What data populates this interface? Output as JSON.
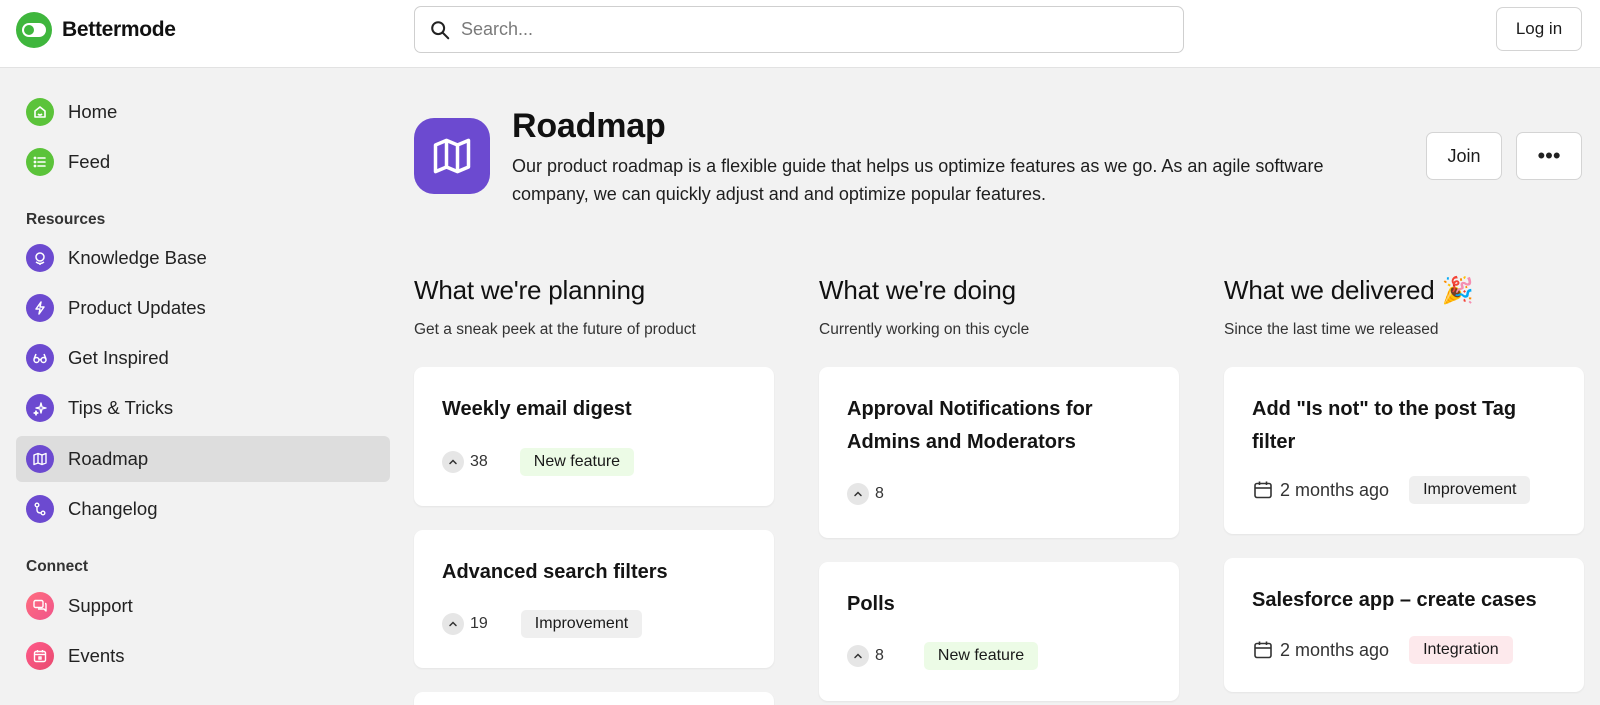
{
  "header": {
    "brand": "Bettermode",
    "search_placeholder": "Search...",
    "login_label": "Log in"
  },
  "sidebar": {
    "items": [
      {
        "label": "Home",
        "icon": "home-icon"
      },
      {
        "label": "Feed",
        "icon": "list-icon"
      }
    ],
    "resources_label": "Resources",
    "resources": [
      {
        "label": "Knowledge Base",
        "icon": "globe-icon"
      },
      {
        "label": "Product Updates",
        "icon": "lightning-icon"
      },
      {
        "label": "Get Inspired",
        "icon": "glasses-icon"
      },
      {
        "label": "Tips & Tricks",
        "icon": "sparkle-icon"
      },
      {
        "label": "Roadmap",
        "icon": "map-icon",
        "active": true
      },
      {
        "label": "Changelog",
        "icon": "branch-icon"
      }
    ],
    "connect_label": "Connect",
    "connect": [
      {
        "label": "Support",
        "icon": "chat-icon"
      },
      {
        "label": "Events",
        "icon": "calendar-icon"
      }
    ]
  },
  "space": {
    "title": "Roadmap",
    "description": "Our product roadmap is a flexible guide that helps us optimize features as we go. As an agile software company, we can quickly adjust and and optimize popular features.",
    "join_label": "Join",
    "more_label": "•••"
  },
  "columns": [
    {
      "title": "What we're planning",
      "subtitle": "Get a sneak peek at the future of product",
      "cards": [
        {
          "title": "Weekly email digest",
          "votes": "38",
          "tag": "New feature"
        },
        {
          "title": "Advanced search filters",
          "votes": "19",
          "tag": "Improvement"
        }
      ]
    },
    {
      "title": "What we're doing",
      "subtitle": "Currently working on this cycle",
      "cards": [
        {
          "title": "Approval Notifications for Admins and Moderators",
          "votes": "8"
        },
        {
          "title": "Polls",
          "votes": "8",
          "tag": "New feature"
        }
      ]
    },
    {
      "title": "What we delivered 🎉",
      "subtitle": "Since the last time we released",
      "cards": [
        {
          "title": "Add \"Is not\" to the post Tag filter",
          "date": "2 months ago",
          "tag": "Improvement"
        },
        {
          "title": "Salesforce app – create cases",
          "date": "2 months ago",
          "tag": "Integration"
        }
      ]
    }
  ],
  "colors": {
    "brand_green": "#3fb63d",
    "accent_purple": "#6c4ad0",
    "new_feature_bg": "#ecfbe6",
    "improvement_bg": "#efefef",
    "integration_bg": "#fde9ec"
  }
}
